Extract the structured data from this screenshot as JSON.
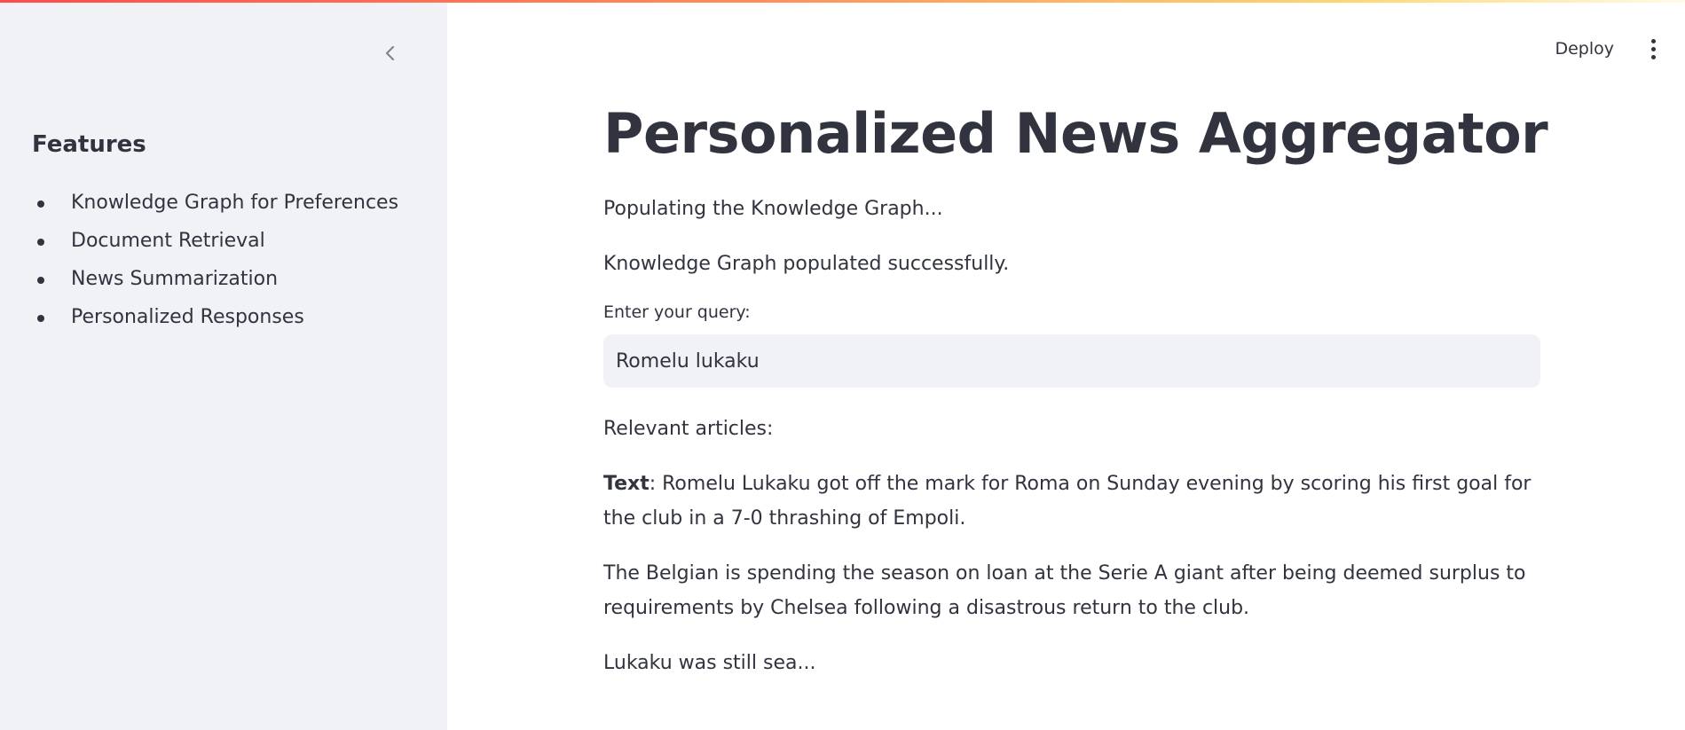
{
  "sidebar": {
    "title": "Features",
    "items": [
      {
        "label": "Knowledge Graph for Preferences"
      },
      {
        "label": "Document Retrieval"
      },
      {
        "label": "News Summarization"
      },
      {
        "label": "Personalized Responses"
      }
    ],
    "collapse_icon": "chevron-left-icon"
  },
  "header": {
    "deploy_label": "Deploy",
    "menu_icon": "vertical-ellipsis-icon"
  },
  "main": {
    "title": "Personalized News Aggregator",
    "title_icon": "newspaper-icon",
    "status_populating": "Populating the Knowledge Graph...",
    "status_done": "Knowledge Graph populated successfully.",
    "query": {
      "label": "Enter your query:",
      "value": "Romelu lukaku"
    },
    "results_label": "Relevant articles:",
    "article": {
      "text_label": "Text",
      "paragraph1": ": Romelu Lukaku got off the mark for Roma on Sunday evening by scoring his first goal for the club in a 7-0 thrashing of Empoli.",
      "paragraph2": "The Belgian is spending the season on loan at the Serie A giant after being deemed surplus to requirements by Chelsea following a disastrous return to the club.",
      "paragraph3": "Lukaku was still sea..."
    }
  },
  "colors": {
    "sidebar_bg": "#f0f2f6",
    "text": "#31333f",
    "input_bg": "#f0f2f6",
    "accent_gradient_start": "#ff4b4b",
    "accent_gradient_end": "#fffbe8"
  }
}
